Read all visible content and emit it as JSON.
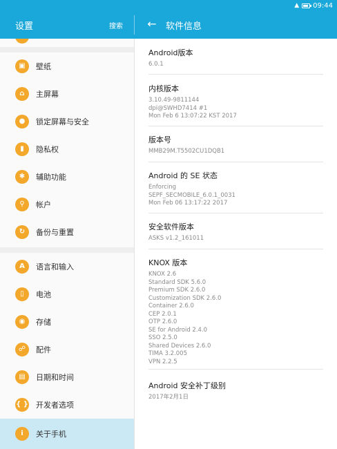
{
  "status": {
    "time": "09:44"
  },
  "header": {
    "left_title": "设置",
    "search_label": "搜索",
    "right_title": "软件信息"
  },
  "sidebar": {
    "items": [
      {
        "label": "壁纸",
        "icon": "wallpaper-icon"
      },
      {
        "label": "主屏幕",
        "icon": "home-icon"
      },
      {
        "label": "锁定屏幕与安全",
        "icon": "lock-icon"
      },
      {
        "label": "隐私权",
        "icon": "privacy-icon"
      },
      {
        "label": "辅助功能",
        "icon": "accessibility-icon"
      },
      {
        "label": "帐户",
        "icon": "key-icon"
      },
      {
        "label": "备份与重置",
        "icon": "backup-icon"
      },
      {
        "label": "语言和输入",
        "icon": "language-icon"
      },
      {
        "label": "电池",
        "icon": "battery-icon"
      },
      {
        "label": "存储",
        "icon": "storage-icon"
      },
      {
        "label": "配件",
        "icon": "accessory-icon"
      },
      {
        "label": "日期和时间",
        "icon": "calendar-icon"
      },
      {
        "label": "开发者选项",
        "icon": "developer-icon"
      },
      {
        "label": "关于手机",
        "icon": "info-icon"
      }
    ],
    "accent_color": "#f4a82b",
    "active_color": "#cbe8f5"
  },
  "info": [
    {
      "title": "Android版本",
      "lines": [
        "6.0.1"
      ]
    },
    {
      "title": "内核版本",
      "lines": [
        "3.10.49-9811144",
        "dpi@SWHD7414 #1",
        "Mon Feb 6 13:07:22 KST 2017"
      ]
    },
    {
      "title": "版本号",
      "lines": [
        "MMB29M.T5502CU1DQB1"
      ]
    },
    {
      "title": "Android 的 SE 状态",
      "lines": [
        "Enforcing",
        "SEPF_SECMOBILE_6.0.1_0031",
        "Mon Feb 06 13:17:22 2017"
      ]
    },
    {
      "title": "安全软件版本",
      "lines": [
        "ASKS v1.2_161011"
      ]
    },
    {
      "title": "KNOX 版本",
      "lines": [
        "KNOX 2.6",
        "Standard SDK 5.6.0",
        "Premium SDK 2.6.0",
        "Customization SDK 2.6.0",
        "Container 2.6.0",
        "CEP 2.0.1",
        "OTP 2.6.0",
        "SE for Android 2.4.0",
        "SSO 2.5.0",
        "Shared Devices 2.6.0",
        "TIMA 3.2.005",
        "VPN 2.2.5"
      ]
    },
    {
      "title": "Android 安全补丁级别",
      "lines": [
        "2017年2月1日"
      ]
    }
  ],
  "colors": {
    "appbar": "#1aa7d9"
  }
}
